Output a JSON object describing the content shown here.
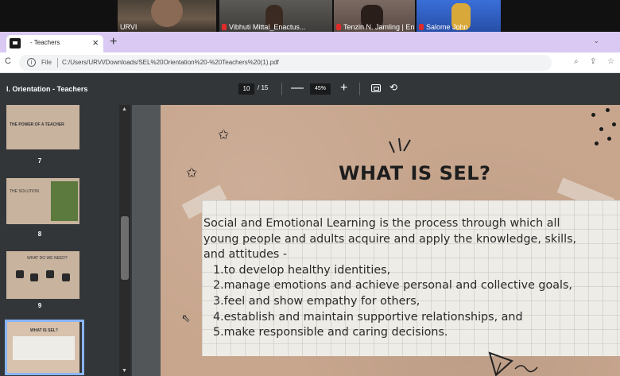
{
  "video_call": {
    "participants": [
      {
        "name": "URVI",
        "muted": false
      },
      {
        "name": "Vibhuti Mittal_Enactus...",
        "muted": true
      },
      {
        "name": "Tenzin N. Jamling | En...",
        "muted": true
      },
      {
        "name": "Salome John",
        "muted": true
      }
    ]
  },
  "browser": {
    "tab_title": "- Teachers",
    "tab_close": "×",
    "new_tab": "+",
    "tab_dropdown": "⌄",
    "reload": "C",
    "info": "i",
    "scheme": "File",
    "url": "C:/Users/URVI/Downloads/SEL%20Orientation%20-%20Teachers%20(1).pdf",
    "icons": [
      "zoom-icon",
      "share-icon",
      "star-icon"
    ]
  },
  "pdf_toolbar": {
    "title": "l. Orientation - Teachers",
    "page_current": "10",
    "page_total": "/ 15",
    "zoom_minus": "—",
    "zoom": "45%",
    "zoom_plus": "+"
  },
  "sidebar": {
    "thumbnails": [
      {
        "page": "7",
        "title": "THE POWER OF A TEACHER"
      },
      {
        "page": "8",
        "title": "THE SOLUTION"
      },
      {
        "page": "9",
        "title": "WHAT DO WE NEED?"
      },
      {
        "page": "10",
        "title": "WHAT IS SEL?"
      }
    ]
  },
  "slide": {
    "title": "WHAT IS SEL?",
    "paragraph": [
      "Social and Emotional Learning is the process through which all",
      "young people and adults acquire and apply the knowledge, skills,",
      "and attitudes -"
    ],
    "items": [
      "1.to develop healthy identities,",
      "2.manage emotions and achieve personal and collective goals,",
      "3.feel and show empathy for others,",
      "4.establish and maintain supportive relationships, and",
      "5.make responsible and caring decisions."
    ]
  }
}
